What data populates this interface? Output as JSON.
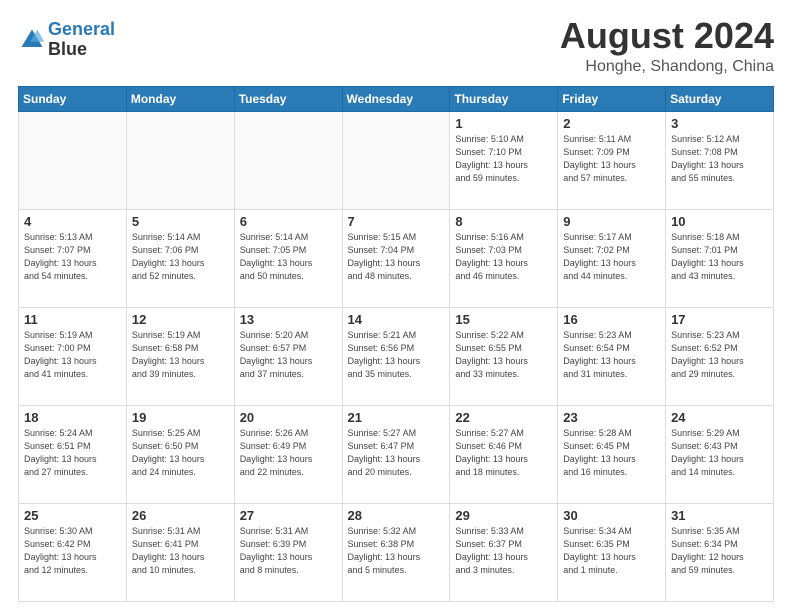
{
  "header": {
    "logo_line1": "General",
    "logo_line2": "Blue",
    "month_year": "August 2024",
    "location": "Honghe, Shandong, China"
  },
  "weekdays": [
    "Sunday",
    "Monday",
    "Tuesday",
    "Wednesday",
    "Thursday",
    "Friday",
    "Saturday"
  ],
  "weeks": [
    [
      {
        "day": "",
        "info": ""
      },
      {
        "day": "",
        "info": ""
      },
      {
        "day": "",
        "info": ""
      },
      {
        "day": "",
        "info": ""
      },
      {
        "day": "1",
        "info": "Sunrise: 5:10 AM\nSunset: 7:10 PM\nDaylight: 13 hours\nand 59 minutes."
      },
      {
        "day": "2",
        "info": "Sunrise: 5:11 AM\nSunset: 7:09 PM\nDaylight: 13 hours\nand 57 minutes."
      },
      {
        "day": "3",
        "info": "Sunrise: 5:12 AM\nSunset: 7:08 PM\nDaylight: 13 hours\nand 55 minutes."
      }
    ],
    [
      {
        "day": "4",
        "info": "Sunrise: 5:13 AM\nSunset: 7:07 PM\nDaylight: 13 hours\nand 54 minutes."
      },
      {
        "day": "5",
        "info": "Sunrise: 5:14 AM\nSunset: 7:06 PM\nDaylight: 13 hours\nand 52 minutes."
      },
      {
        "day": "6",
        "info": "Sunrise: 5:14 AM\nSunset: 7:05 PM\nDaylight: 13 hours\nand 50 minutes."
      },
      {
        "day": "7",
        "info": "Sunrise: 5:15 AM\nSunset: 7:04 PM\nDaylight: 13 hours\nand 48 minutes."
      },
      {
        "day": "8",
        "info": "Sunrise: 5:16 AM\nSunset: 7:03 PM\nDaylight: 13 hours\nand 46 minutes."
      },
      {
        "day": "9",
        "info": "Sunrise: 5:17 AM\nSunset: 7:02 PM\nDaylight: 13 hours\nand 44 minutes."
      },
      {
        "day": "10",
        "info": "Sunrise: 5:18 AM\nSunset: 7:01 PM\nDaylight: 13 hours\nand 43 minutes."
      }
    ],
    [
      {
        "day": "11",
        "info": "Sunrise: 5:19 AM\nSunset: 7:00 PM\nDaylight: 13 hours\nand 41 minutes."
      },
      {
        "day": "12",
        "info": "Sunrise: 5:19 AM\nSunset: 6:58 PM\nDaylight: 13 hours\nand 39 minutes."
      },
      {
        "day": "13",
        "info": "Sunrise: 5:20 AM\nSunset: 6:57 PM\nDaylight: 13 hours\nand 37 minutes."
      },
      {
        "day": "14",
        "info": "Sunrise: 5:21 AM\nSunset: 6:56 PM\nDaylight: 13 hours\nand 35 minutes."
      },
      {
        "day": "15",
        "info": "Sunrise: 5:22 AM\nSunset: 6:55 PM\nDaylight: 13 hours\nand 33 minutes."
      },
      {
        "day": "16",
        "info": "Sunrise: 5:23 AM\nSunset: 6:54 PM\nDaylight: 13 hours\nand 31 minutes."
      },
      {
        "day": "17",
        "info": "Sunrise: 5:23 AM\nSunset: 6:52 PM\nDaylight: 13 hours\nand 29 minutes."
      }
    ],
    [
      {
        "day": "18",
        "info": "Sunrise: 5:24 AM\nSunset: 6:51 PM\nDaylight: 13 hours\nand 27 minutes."
      },
      {
        "day": "19",
        "info": "Sunrise: 5:25 AM\nSunset: 6:50 PM\nDaylight: 13 hours\nand 24 minutes."
      },
      {
        "day": "20",
        "info": "Sunrise: 5:26 AM\nSunset: 6:49 PM\nDaylight: 13 hours\nand 22 minutes."
      },
      {
        "day": "21",
        "info": "Sunrise: 5:27 AM\nSunset: 6:47 PM\nDaylight: 13 hours\nand 20 minutes."
      },
      {
        "day": "22",
        "info": "Sunrise: 5:27 AM\nSunset: 6:46 PM\nDaylight: 13 hours\nand 18 minutes."
      },
      {
        "day": "23",
        "info": "Sunrise: 5:28 AM\nSunset: 6:45 PM\nDaylight: 13 hours\nand 16 minutes."
      },
      {
        "day": "24",
        "info": "Sunrise: 5:29 AM\nSunset: 6:43 PM\nDaylight: 13 hours\nand 14 minutes."
      }
    ],
    [
      {
        "day": "25",
        "info": "Sunrise: 5:30 AM\nSunset: 6:42 PM\nDaylight: 13 hours\nand 12 minutes."
      },
      {
        "day": "26",
        "info": "Sunrise: 5:31 AM\nSunset: 6:41 PM\nDaylight: 13 hours\nand 10 minutes."
      },
      {
        "day": "27",
        "info": "Sunrise: 5:31 AM\nSunset: 6:39 PM\nDaylight: 13 hours\nand 8 minutes."
      },
      {
        "day": "28",
        "info": "Sunrise: 5:32 AM\nSunset: 6:38 PM\nDaylight: 13 hours\nand 5 minutes."
      },
      {
        "day": "29",
        "info": "Sunrise: 5:33 AM\nSunset: 6:37 PM\nDaylight: 13 hours\nand 3 minutes."
      },
      {
        "day": "30",
        "info": "Sunrise: 5:34 AM\nSunset: 6:35 PM\nDaylight: 13 hours\nand 1 minute."
      },
      {
        "day": "31",
        "info": "Sunrise: 5:35 AM\nSunset: 6:34 PM\nDaylight: 12 hours\nand 59 minutes."
      }
    ]
  ]
}
